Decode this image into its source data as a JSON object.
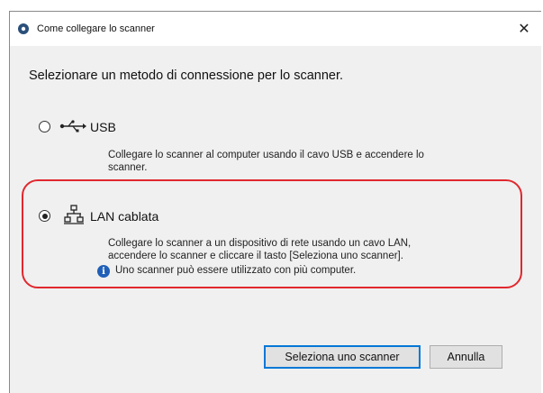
{
  "window": {
    "title": "Come collegare lo scanner",
    "close_glyph": "✕"
  },
  "prompt": "Selezionare un metodo di connessione per lo scanner.",
  "options": [
    {
      "label": "USB",
      "description_lines": [
        "Collegare lo scanner al computer usando il cavo USB e accendere lo",
        "scanner."
      ],
      "selected": false,
      "icon": "usb-icon"
    },
    {
      "label": "LAN cablata",
      "description_lines": [
        "Collegare lo scanner a un dispositivo di rete usando un cavo LAN,",
        "accendere lo scanner e cliccare il tasto [Seleziona uno scanner]."
      ],
      "selected": true,
      "icon": "network-icon",
      "note": "Uno scanner può essere utilizzato con più computer."
    }
  ],
  "buttons": {
    "select_scanner": "Seleziona uno scanner",
    "cancel": "Annulla"
  },
  "colors": {
    "highlight": "#e0282e",
    "info": "#1f5fb8",
    "focus": "#0078d7"
  }
}
